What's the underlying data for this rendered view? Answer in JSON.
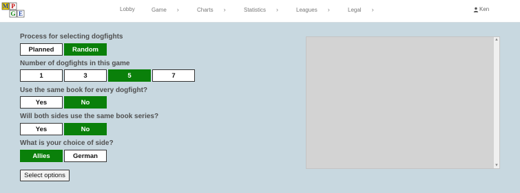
{
  "nav": {
    "items": [
      {
        "label": "Lobby"
      },
      {
        "label": "Game"
      },
      {
        "label": "Charts"
      },
      {
        "label": "Statistics"
      },
      {
        "label": "Leagues"
      },
      {
        "label": "Legal"
      }
    ],
    "user": "Ken",
    "logo_letters": [
      "M",
      "P",
      "G",
      "E"
    ]
  },
  "sections": [
    {
      "label": "Process for selecting dogfights",
      "options": [
        "Planned",
        "Random"
      ],
      "selected": 1
    },
    {
      "label": "Number of dogfights in this game",
      "options": [
        "1",
        "3",
        "5",
        "7"
      ],
      "selected": 2
    },
    {
      "label": "Use the same book for every dogfight?",
      "options": [
        "Yes",
        "No"
      ],
      "selected": 1
    },
    {
      "label": "Will both sides use the same book series?",
      "options": [
        "Yes",
        "No"
      ],
      "selected": 1
    },
    {
      "label": "What is your choice of side?",
      "options": [
        "Allies",
        "German"
      ],
      "selected": 0
    }
  ],
  "submit_label": "Select options",
  "colors": {
    "accent": "#0a800a",
    "background": "#c8d8e0",
    "panel": "#d3d3d3"
  }
}
